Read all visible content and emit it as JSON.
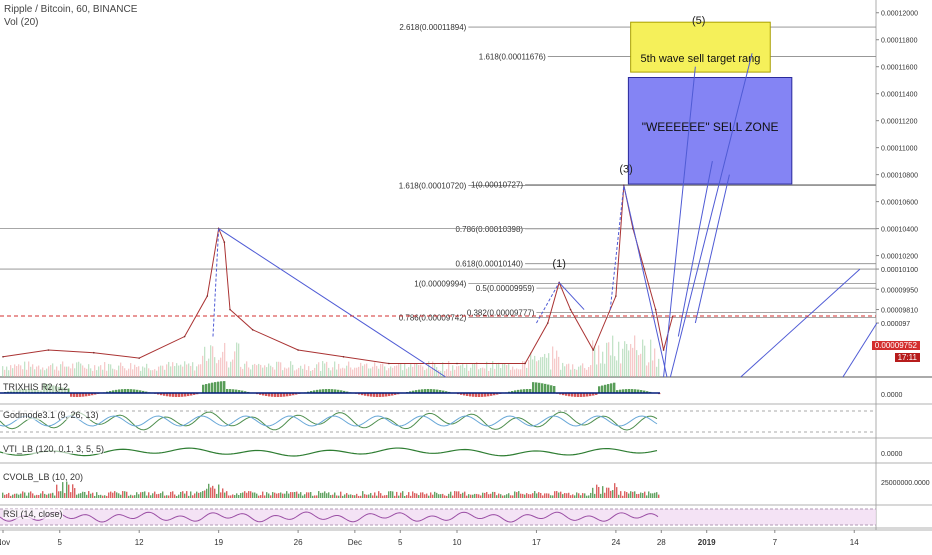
{
  "header": {
    "title": "Ripple / Bitcoin, 60, BINANCE",
    "volume_label": "Vol (20)"
  },
  "colors": {
    "current_price": "#d32f2f",
    "drawing_line": "#4f5bd5",
    "sell_zone": "#5b5bf0",
    "target_box": "#f5f05a",
    "indicator_green": "#3c8c3c",
    "indicator_red": "#d33a3a",
    "rsi_band": "#f1dcf3",
    "rsi_line": "#9b4fa5"
  },
  "chart_data": [
    {
      "type": "line",
      "name": "Ripple / Bitcoin price (60 min)",
      "ylim": [
        9.3e-06,
        1.205e-05
      ],
      "y_ticks": [
        {
          "value": 1.2e-05,
          "label": "0.00012000"
        },
        {
          "value": 1.18e-05,
          "label": "0.00011800"
        },
        {
          "value": 1.16e-05,
          "label": "0.00011600"
        },
        {
          "value": 1.14e-05,
          "label": "0.00011400"
        },
        {
          "value": 1.12e-05,
          "label": "0.00011200"
        },
        {
          "value": 1.1e-05,
          "label": "0.00011000"
        },
        {
          "value": 1.08e-05,
          "label": "0.00010800"
        },
        {
          "value": 1.06e-05,
          "label": "0.00010600"
        },
        {
          "value": 1.04e-05,
          "label": "0.00010400"
        },
        {
          "value": 1.02e-05,
          "label": "0.00010200"
        },
        {
          "value": 1.01e-05,
          "label": "0.00010100"
        },
        {
          "value": 9.95e-06,
          "label": "0.00009950"
        },
        {
          "value": 9.8e-06,
          "label": "0.00009810"
        },
        {
          "value": 9.7e-06,
          "label": "0.000097"
        }
      ],
      "x_ticks": [
        {
          "label": "Nov",
          "day": 0
        },
        {
          "label": "5",
          "day": 5
        },
        {
          "label": "12",
          "day": 12
        },
        {
          "label": "19",
          "day": 19
        },
        {
          "label": "26",
          "day": 26
        },
        {
          "label": "Dec",
          "day": 31
        },
        {
          "label": "5",
          "day": 35
        },
        {
          "label": "10",
          "day": 40
        },
        {
          "label": "17",
          "day": 47
        },
        {
          "label": "24",
          "day": 54
        },
        {
          "label": "28",
          "day": 58
        },
        {
          "label": "2019",
          "day": 62
        },
        {
          "label": "7",
          "day": 68
        },
        {
          "label": "14",
          "day": 75
        }
      ],
      "price_path": [
        {
          "day": 0,
          "y": 9.45e-06
        },
        {
          "day": 4,
          "y": 9.5e-06
        },
        {
          "day": 8,
          "y": 9.48e-06
        },
        {
          "day": 12,
          "y": 9.44e-06
        },
        {
          "day": 16,
          "y": 9.6e-06
        },
        {
          "day": 18,
          "y": 9.9e-06
        },
        {
          "day": 19,
          "y": 1.04e-05
        },
        {
          "day": 19.5,
          "y": 1.03e-05
        },
        {
          "day": 20,
          "y": 9.8e-06
        },
        {
          "day": 22,
          "y": 9.65e-06
        },
        {
          "day": 26,
          "y": 9.5e-06
        },
        {
          "day": 30,
          "y": 9.45e-06
        },
        {
          "day": 34,
          "y": 9.4e-06
        },
        {
          "day": 40,
          "y": 9.4e-06
        },
        {
          "day": 46,
          "y": 9.4e-06
        },
        {
          "day": 48,
          "y": 9.7e-06
        },
        {
          "day": 49,
          "y": 1e-05
        },
        {
          "day": 50,
          "y": 9.8e-06
        },
        {
          "day": 52,
          "y": 9.5e-06
        },
        {
          "day": 54,
          "y": 9.9e-06
        },
        {
          "day": 54.7,
          "y": 1.072e-05
        },
        {
          "day": 55.5,
          "y": 1.04e-05
        },
        {
          "day": 56.5,
          "y": 1.01e-05
        },
        {
          "day": 57.5,
          "y": 9.8e-06
        },
        {
          "day": 58.2,
          "y": 9.5e-06
        },
        {
          "day": 59,
          "y": 9.75e-06
        }
      ],
      "current_price": {
        "value": 9.752e-06,
        "label": "0.00009752",
        "countdown": "17:11"
      },
      "fib_levels": [
        {
          "label": "2.618(0.00011894)",
          "value": 1.1894e-05,
          "x_from_day": 41
        },
        {
          "label": "1.618(0.00011676)",
          "value": 1.1676e-05,
          "x_from_day": 48
        },
        {
          "label": "1.618(0.00010720)",
          "value": 1.072e-05,
          "x_from_day": 41
        },
        {
          "label": "1(0.00010727)",
          "value": 1.0727e-05,
          "x_from_day": 46
        },
        {
          "label": "0.786(0.00010398)",
          "value": 1.0398e-05,
          "x_from_day": 46
        },
        {
          "label": "0.618(0.00010140)",
          "value": 1.014e-05,
          "x_from_day": 46
        },
        {
          "label": "1(0.00009994)",
          "value": 9.994e-06,
          "x_from_day": 41
        },
        {
          "label": "0.5(0.00009959)",
          "value": 9.959e-06,
          "x_from_day": 47
        },
        {
          "label": "0.382(0.00009777)",
          "value": 9.777e-06,
          "x_from_day": 47
        },
        {
          "label": "0.786(0.00009742)",
          "value": 9.742e-06,
          "x_from_day": 41
        }
      ],
      "wave_labels": [
        {
          "label": "(1)",
          "day": 49,
          "value": 1.01e-05
        },
        {
          "label": "(3)",
          "day": 54.9,
          "value": 1.08e-05
        },
        {
          "label": "(5)",
          "day": 61.3,
          "value": 1.19e-05
        }
      ],
      "annotations": [
        {
          "text": "5th wave sell target rang"
        },
        {
          "text": "\"WEEEEEE\" SELL ZONE"
        }
      ]
    },
    {
      "type": "area",
      "name": "TRIXHIS R2 (12",
      "ylim": [
        -1,
        1
      ],
      "y_ticks": [
        {
          "value": 0,
          "label": "0.0000"
        }
      ]
    },
    {
      "type": "line",
      "name": "Godmode3.1 (9, 26, 13)",
      "ylim": [
        0,
        100
      ]
    },
    {
      "type": "line",
      "name": "VTI_LB (120, 0.1, 3, 5, 5)",
      "ylim": [
        -1,
        1
      ],
      "y_ticks": [
        {
          "value": 0,
          "label": "0.0000"
        }
      ]
    },
    {
      "type": "bar",
      "name": "CVOLB_LB (10, 20)",
      "y_ticks": [
        {
          "value": 25000000,
          "label": "25000000.0000"
        }
      ]
    },
    {
      "type": "line",
      "name": "RSI (14, close)",
      "ylim": [
        0,
        100
      ]
    }
  ],
  "panels": {
    "trix": "TRIXHIS R2 (12",
    "godmode": "Godmode3.1 (9, 26, 13)",
    "vti": "VTI_LB (120, 0.1, 3, 5, 5)",
    "cvol": "CVOLB_LB (10, 20)",
    "rsi": "RSI (14, close)"
  }
}
